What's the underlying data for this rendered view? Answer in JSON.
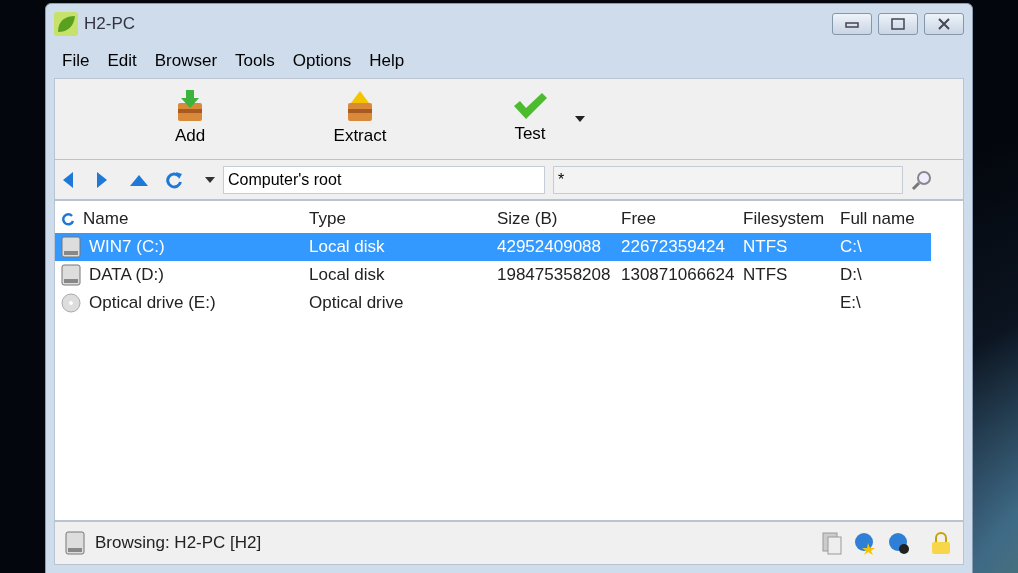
{
  "window": {
    "title": "H2-PC"
  },
  "menu": [
    "File",
    "Edit",
    "Browser",
    "Tools",
    "Options",
    "Help"
  ],
  "toolbar": [
    {
      "label": "Add",
      "kind": "add"
    },
    {
      "label": "Extract",
      "kind": "extract"
    },
    {
      "label": "Test",
      "kind": "test"
    }
  ],
  "address": {
    "value": "Computer's root"
  },
  "filter": {
    "value": "*"
  },
  "table": {
    "columns": [
      "Name",
      "Type",
      "Size (B)",
      "Free",
      "Filesystem",
      "Full name"
    ],
    "rows": [
      {
        "kind": "disk",
        "selected": true,
        "cells": [
          "WIN7 (C:)",
          "Local disk",
          "42952409088",
          "22672359424",
          "NTFS",
          "C:\\"
        ]
      },
      {
        "kind": "disk",
        "selected": false,
        "cells": [
          "DATA (D:)",
          "Local disk",
          "198475358208",
          "130871066624",
          "NTFS",
          "D:\\"
        ]
      },
      {
        "kind": "optical",
        "selected": false,
        "cells": [
          "Optical drive (E:)",
          "Optical drive",
          "",
          "",
          "",
          "E:\\"
        ]
      }
    ]
  },
  "status_bar": {
    "text": "Browsing: H2-PC [H2]"
  }
}
